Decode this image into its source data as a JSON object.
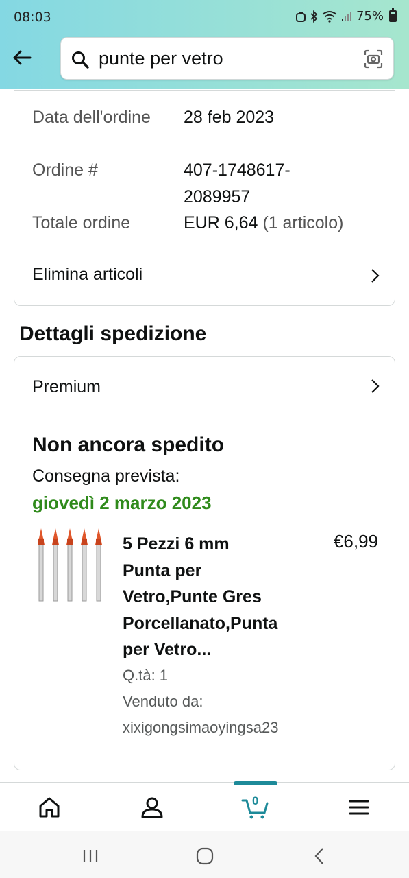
{
  "status_bar": {
    "time": "08:03",
    "battery": "75%",
    "icons": [
      "alarm-icon",
      "bluetooth-icon",
      "wifi-icon",
      "signal-icon",
      "battery-icon"
    ]
  },
  "search": {
    "query": "punte per vetro",
    "icons": [
      "back-arrow-icon",
      "search-icon",
      "camera-icon"
    ]
  },
  "order": {
    "date_label": "Data dell'ordine",
    "date_value": "28 feb 2023",
    "number_label": "Ordine #",
    "number_value_line1": "407-1748617-",
    "number_value_line2": "2089957",
    "total_label": "Totale ordine",
    "total_value": "EUR 6,64",
    "total_items": "(1 articolo)",
    "delete_items": "Elimina articoli"
  },
  "shipping": {
    "section_title": "Dettagli spedizione",
    "shipping_type": "Premium",
    "status": "Non ancora spedito",
    "delivery_label": "Consegna prevista:",
    "delivery_date": "giovedì 2 marzo 2023",
    "product": {
      "title_lines": [
        "5 Pezzi 6 mm",
        "Punta per",
        "Vetro,Punte Gres",
        "Porcellanato,Punta",
        "per Vetro..."
      ],
      "price": "€6,99",
      "quantity": "Q.tà: 1",
      "sold_by_label": "Venduto da:",
      "seller": "xixigongsimaoyingsa23",
      "image": "drill-bits-image"
    }
  },
  "bottom_nav": {
    "cart_count": "0",
    "items": [
      "home-icon",
      "account-icon",
      "cart-icon",
      "menu-icon"
    ]
  },
  "colors": {
    "header_gradient_start": "#84d8e3",
    "header_gradient_end": "#a6e6ce",
    "delivery_green": "#2f8a1b",
    "cart_accent": "#1d8a99"
  }
}
